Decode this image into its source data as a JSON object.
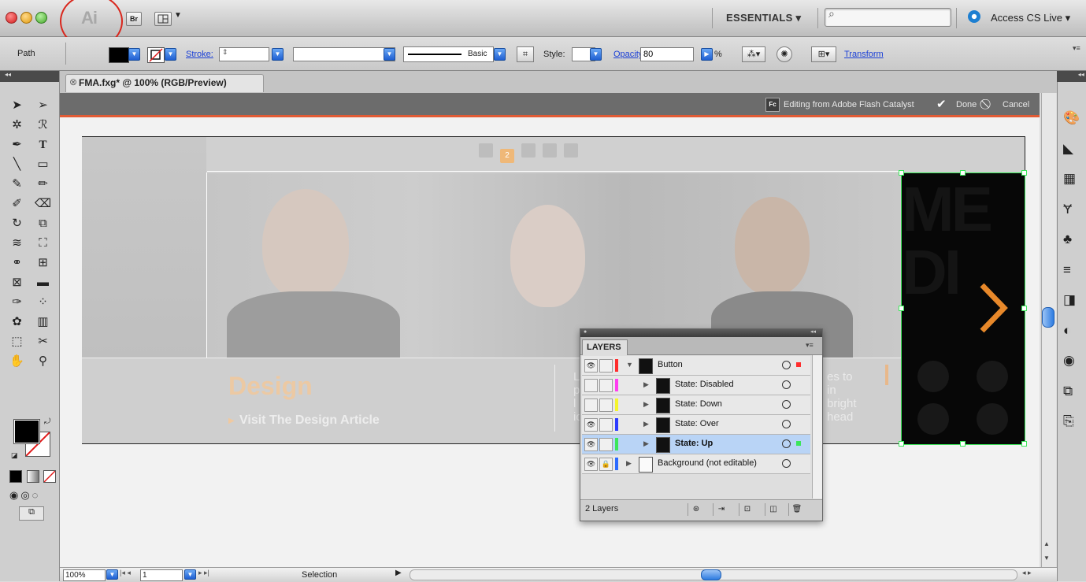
{
  "app": {
    "logo_text": "Ai",
    "bridge_label": "Br",
    "workspace": "ESSENTIALS ▾",
    "cs_live": "Access CS Live ▾",
    "search_placeholder": ""
  },
  "control_bar": {
    "selection_type": "Path",
    "stroke_label": "Stroke:",
    "brush_label": "Basic",
    "style_label": "Style:",
    "opacity_label": "Opacity:",
    "opacity_value": "80",
    "opacity_unit": "%",
    "transform_label": "Transform"
  },
  "document": {
    "tab_title": "FMA.fxg* @ 100% (RGB/Preview)",
    "fc_badge": "Fc",
    "fc_status": "Editing from Adobe Flash Catalyst",
    "done_label": "Done",
    "cancel_label": "Cancel"
  },
  "artboard": {
    "pager_active": "2",
    "headline": "Design",
    "cta": "Visit The Design Article",
    "side_text_left": [
      "L",
      "p",
      "l",
      "ic"
    ],
    "side_text_right": [
      "es to",
      "in",
      "bright",
      "head"
    ],
    "selected_bg_text": [
      "ME",
      "DI"
    ]
  },
  "layers_panel": {
    "tab": "LAYERS",
    "rows": [
      {
        "name": "Button",
        "color": "#ff2d2d",
        "visible": true,
        "expanded": true,
        "indent": 0,
        "bold": false,
        "selected": false
      },
      {
        "name": "State: Disabled",
        "color": "#ff3df0",
        "visible": false,
        "expanded": false,
        "indent": 1,
        "bold": false,
        "selected": false
      },
      {
        "name": "State: Down",
        "color": "#f5f52d",
        "visible": false,
        "expanded": false,
        "indent": 1,
        "bold": false,
        "selected": false
      },
      {
        "name": "State: Over",
        "color": "#2d3bff",
        "visible": true,
        "expanded": false,
        "indent": 1,
        "bold": false,
        "selected": false
      },
      {
        "name": "State: Up",
        "color": "#3ce65a",
        "visible": true,
        "expanded": false,
        "indent": 1,
        "bold": true,
        "selected": true
      },
      {
        "name": "Background (not editable)",
        "color": "#2d6bff",
        "visible": true,
        "expanded": false,
        "indent": 0,
        "bold": false,
        "selected": false,
        "locked": true
      }
    ],
    "count_label": "2 Layers"
  },
  "status_bar": {
    "zoom": "100%",
    "page": "1",
    "tool": "Selection"
  },
  "colors": {
    "accent_orange": "#e7882a",
    "catalyst_bar": "#6c6c6c",
    "selection_green": "#3ce65a"
  }
}
